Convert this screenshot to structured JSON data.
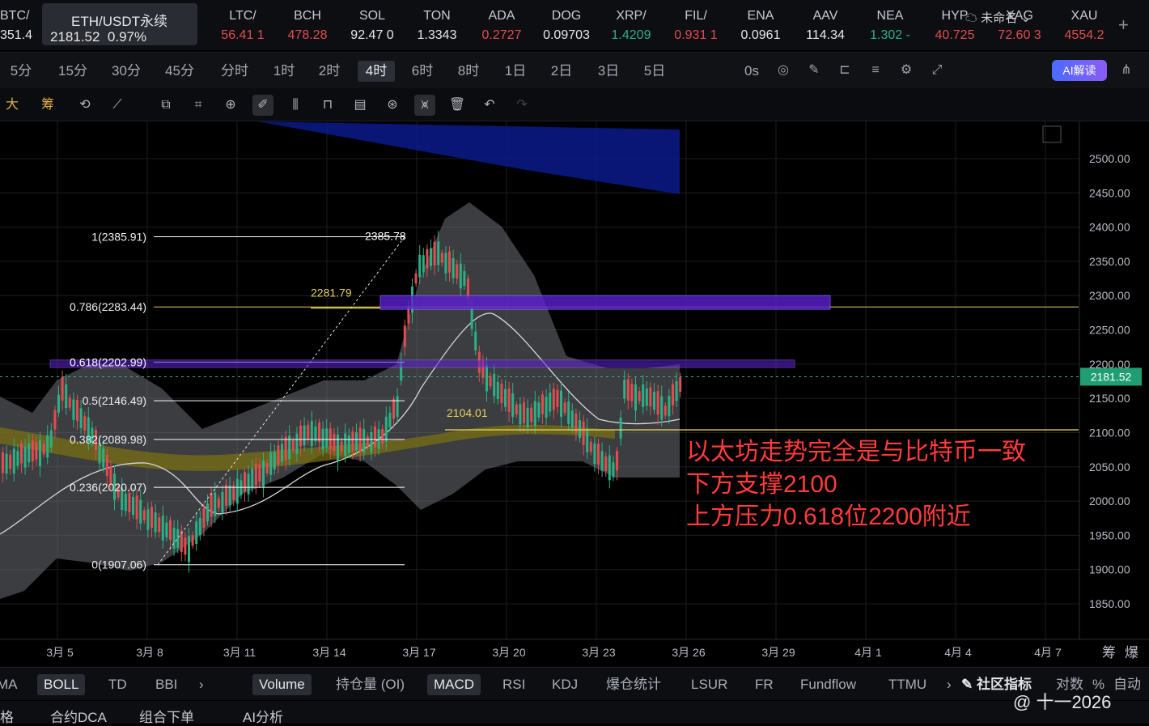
{
  "ticker": {
    "items": [
      {
        "symbol": "BTC/",
        "price": "351.4",
        "dir": "wh"
      },
      {
        "symbol": "LTC/",
        "price": "56.41 1",
        "dir": "dn"
      },
      {
        "symbol": "BCH",
        "price": "478.28",
        "dir": "dn"
      },
      {
        "symbol": "SOL",
        "price": "92.47 0",
        "dir": "wh"
      },
      {
        "symbol": "TON",
        "price": "1.3343",
        "dir": "wh"
      },
      {
        "symbol": "ADA",
        "price": "0.2727",
        "dir": "dn"
      },
      {
        "symbol": "DOG",
        "price": "0.09703",
        "dir": "wh"
      },
      {
        "symbol": "XRP/",
        "price": "1.4209",
        "dir": "up"
      },
      {
        "symbol": "FIL/",
        "price": "0.931 1",
        "dir": "dn"
      },
      {
        "symbol": "ENA",
        "price": "0.0961",
        "dir": "wh"
      },
      {
        "symbol": "AAV",
        "price": "114.34",
        "dir": "wh"
      },
      {
        "symbol": "NEA",
        "price": "1.302 -",
        "dir": "up"
      },
      {
        "symbol": "HYP",
        "price": "40.725",
        "dir": "dn"
      },
      {
        "symbol": "XAG",
        "price": "72.60 3",
        "dir": "dn"
      },
      {
        "symbol": "XAU",
        "price": "4554.2",
        "dir": "dn"
      }
    ],
    "active": {
      "symbol": "ETH/USDT永续",
      "price": "2181.52",
      "change": "0.97%"
    },
    "add_icon": "plus-icon",
    "plus_glyph": "+"
  },
  "timeframes": [
    "5分",
    "15分",
    "30分",
    "45分",
    "分时",
    "1时",
    "2时",
    "4时",
    "6时",
    "8时",
    "1日",
    "2日",
    "3日",
    "5日"
  ],
  "timeframe_selected": "4时",
  "toolbar": {
    "countdown": "0s",
    "layout_name": "未命名",
    "ai_label": "AI解读",
    "icons": [
      "camera-icon",
      "pencil-icon",
      "replay-icon",
      "list-icon",
      "settings-icon",
      "fullscreen-icon",
      "cloud-icon",
      "share-icon"
    ]
  },
  "drawtools": {
    "labels": [
      "大",
      "筹"
    ],
    "icons": [
      "draw-auto-icon",
      "pen-off-icon",
      "clone-icon",
      "ruler-icon",
      "zoom-icon",
      "brush-icon",
      "ohlc-icon",
      "lock-icon",
      "note-icon",
      "magnet-icon",
      "filter-icon",
      "trash-icon",
      "undo-icon",
      "redo-icon"
    ]
  },
  "chart": {
    "y_ticks": [
      "2500.00",
      "2450.00",
      "2400.00",
      "2350.00",
      "2300.00",
      "2250.00",
      "2200.00",
      "2150.00",
      "2100.00",
      "2050.00",
      "2000.00",
      "1950.00",
      "1900.00",
      "1850.00"
    ],
    "x_ticks": [
      "3月 5",
      "3月 8",
      "3月 11",
      "3月 14",
      "3月 17",
      "3月 20",
      "3月 23",
      "3月 26",
      "3月 29",
      "4月 1",
      "4月 4",
      "4月 7"
    ],
    "current_price": "2181.52",
    "fib_levels": [
      {
        "label": "1(2385.91)",
        "value": 2385.91
      },
      {
        "label": "0.786(2283.44)",
        "value": 2283.44
      },
      {
        "label": "0.618(2202.99)",
        "value": 2202.99
      },
      {
        "label": "0.5(2146.49)",
        "value": 2146.49
      },
      {
        "label": "0.382(2089.98)",
        "value": 2089.98
      },
      {
        "label": "0.236(2020.07)",
        "value": 2020.07
      },
      {
        "label": "0(1907.06)",
        "value": 1907.06
      }
    ],
    "price_marks": [
      {
        "label": "2385.78",
        "value": 2385.78
      },
      {
        "label": "2281.79",
        "value": 2281.79
      },
      {
        "label": "2104.01",
        "value": 2104.01
      }
    ],
    "annotation": [
      "以太坊走势完全是与比特币一致",
      "下方支撑2100",
      "上方压力0.618位2200附近"
    ],
    "corner_labels": [
      "筹",
      "爆"
    ],
    "colors": {
      "up": "#28b286",
      "down": "#e44b4e",
      "fib": "#ffffff",
      "resistance": "#7b2cff",
      "annotation": "#ff3b3b",
      "yellow": "#e8d35a"
    }
  },
  "indicators": {
    "main": [
      "MA",
      "BOLL",
      "TD",
      "BBI"
    ],
    "main_selected": "BOLL",
    "sub": [
      "Volume",
      "持仓量 (OI)",
      "MACD",
      "RSI",
      "KDJ",
      "爆仓统计",
      "LSUR",
      "FR",
      "Fundflow",
      "TTMU"
    ],
    "sub_selected": [
      "Volume",
      "MACD"
    ],
    "community": "社区指标",
    "right": [
      "对数",
      "%",
      "自动"
    ]
  },
  "bottom": [
    "格",
    "合约DCA",
    "组合下单",
    "AI分析"
  ],
  "watermark": "@ 十一2026"
}
